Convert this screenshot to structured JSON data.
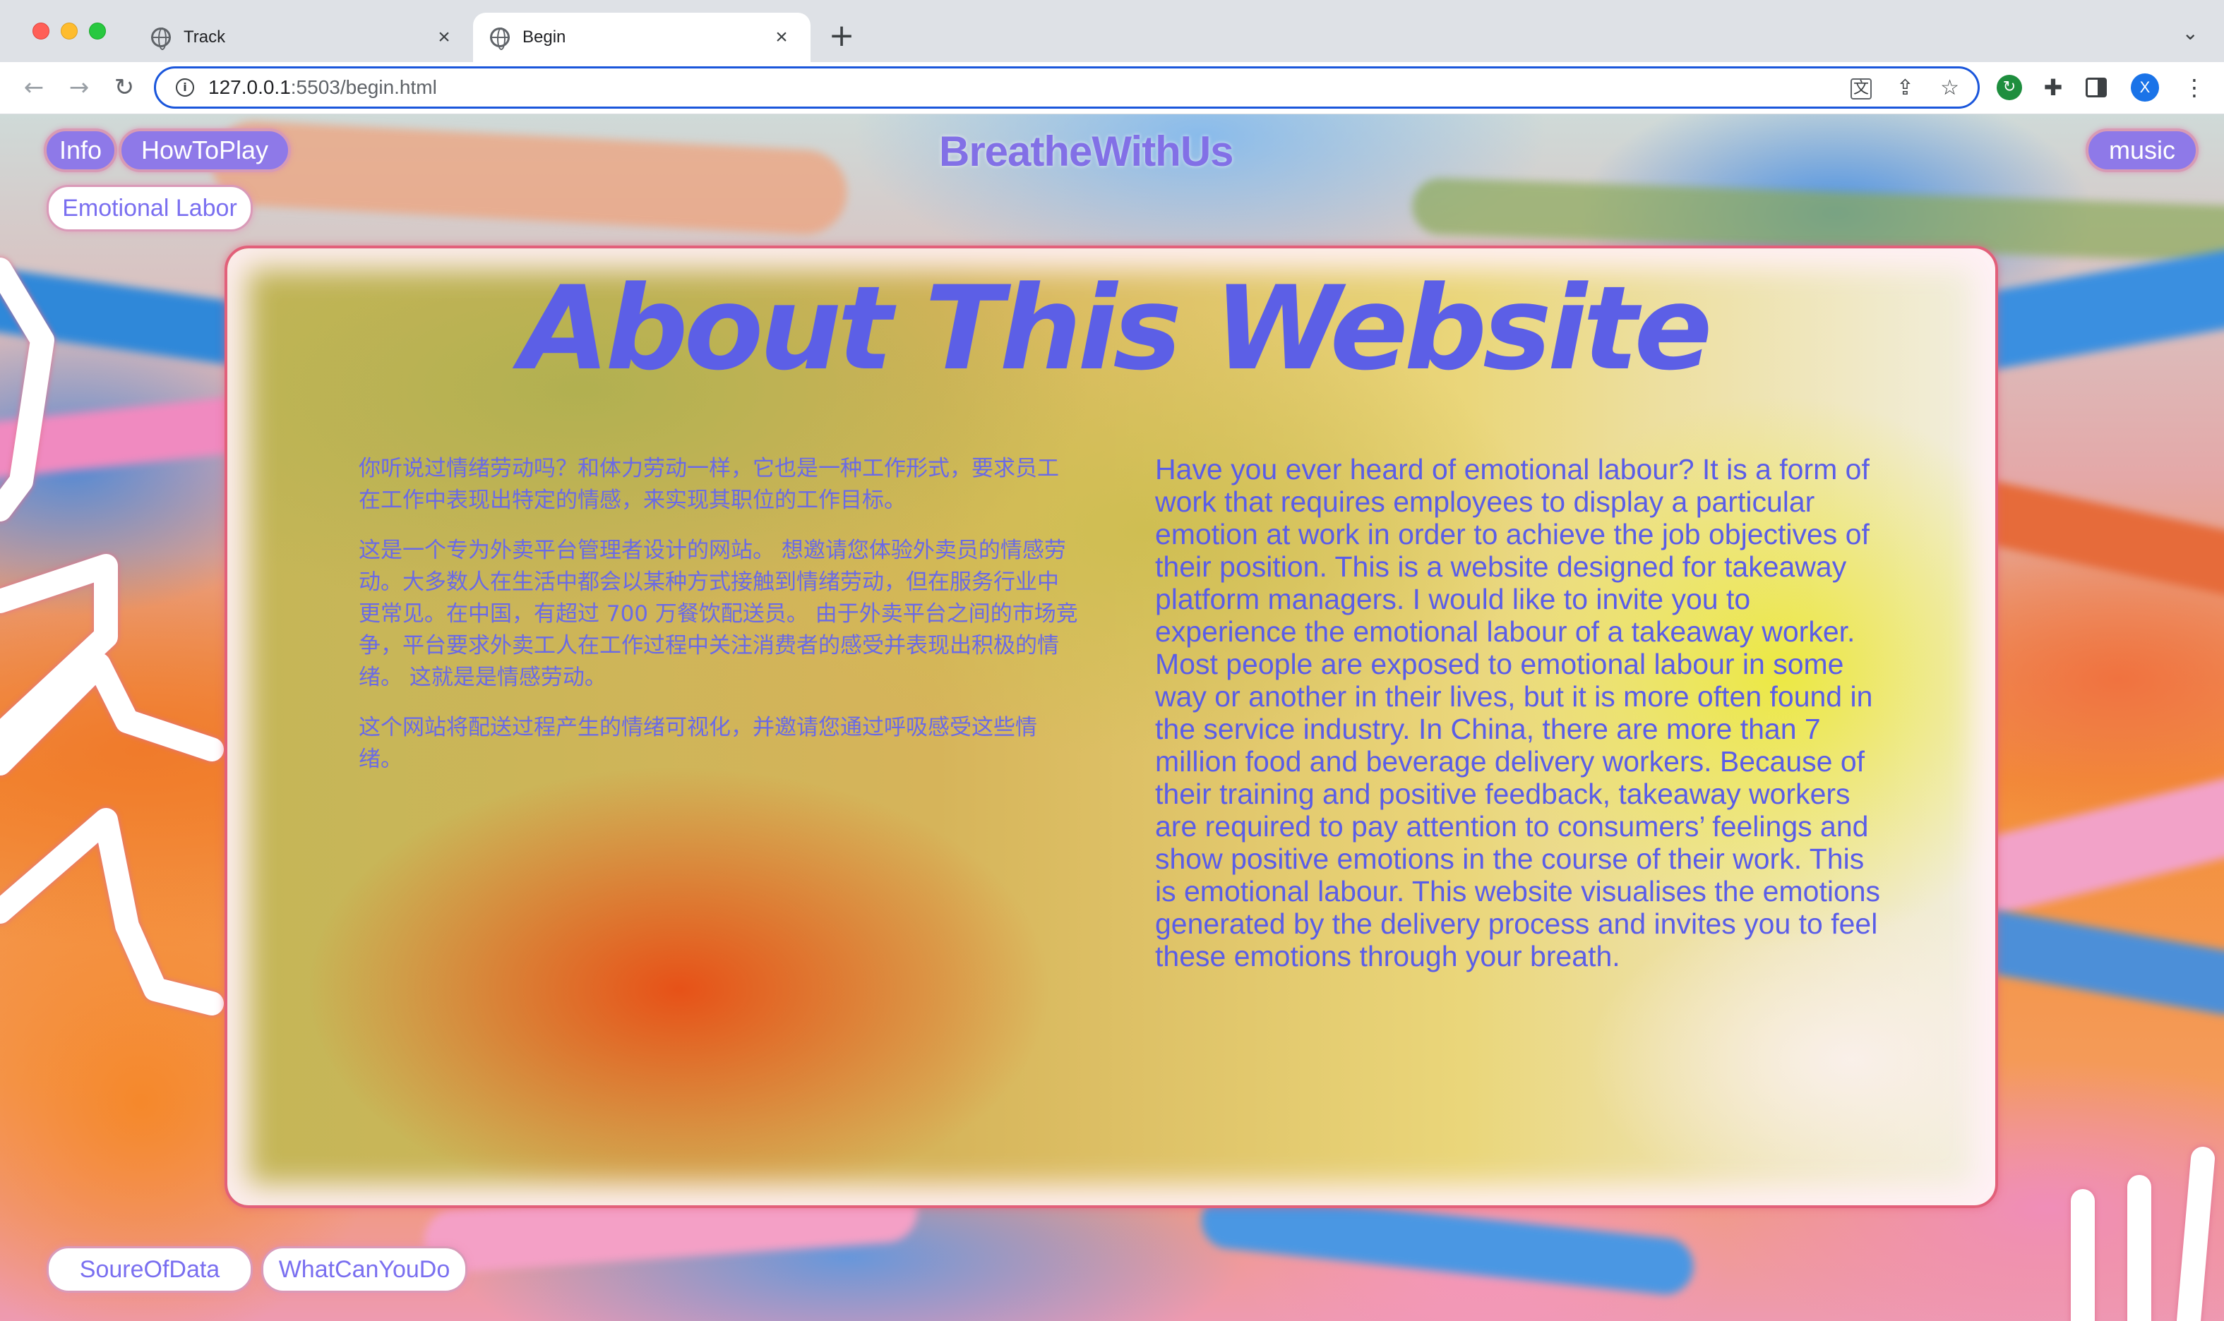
{
  "browser": {
    "tabs": [
      {
        "title": "Track",
        "active": false
      },
      {
        "title": "Begin",
        "active": true
      }
    ],
    "url_host": "127.0.0.1",
    "url_rest": ":5503/begin.html",
    "avatar_letter": "X"
  },
  "nav": {
    "info": "Info",
    "how_to_play": "HowToPlay",
    "music": "music",
    "emotional_labor": "Emotional Labor",
    "source_of_data": "SoureOfData",
    "what_can_you_do": "WhatCanYouDo"
  },
  "site_title": "BreatheWithUs",
  "about": {
    "title": "About This Website",
    "chinese_paragraphs": [
      "你听说过情绪劳动吗？和体力劳动一样，它也是一种工作形式，要求员工在工作中表现出特定的情感，来实现其职位的工作目标。",
      "这是一个专为外卖平台管理者设计的网站。 想邀请您体验外卖员的情感劳动。大多数人在生活中都会以某种方式接触到情绪劳动，但在服务行业中更常见。在中国，有超过 700 万餐饮配送员。 由于外卖平台之间的市场竞争，平台要求外卖工人在工作过程中关注消费者的感受并表现出积极的情绪。 这就是是情感劳动。",
      "这个网站将配送过程产生的情绪可视化，并邀请您通过呼吸感受这些情绪。"
    ],
    "english_text": "Have you ever heard of emotional labour? It is a form of work that requires employees to display a particular emotion at work in order to achieve the job objectives of their position. This is a website designed for takeaway platform managers. I would like to invite you to experience the emotional labour of a takeaway worker. Most people are exposed to emotional labour in some way or another in their lives, but it is more often found in the service industry. In China, there are more than 7 million food and beverage delivery workers. Because of their training and positive feedback, takeaway workers are required to pay attention to consumers’ feelings and show positive emotions in the course of their work. This is emotional labour. This website visualises the emotions generated by the delivery process and invites you to feel these emotions through your breath."
  },
  "colors": {
    "accent_purple": "#5c5fe6",
    "pill_fill": "#8e79e8",
    "card_border": "#e2607a"
  }
}
